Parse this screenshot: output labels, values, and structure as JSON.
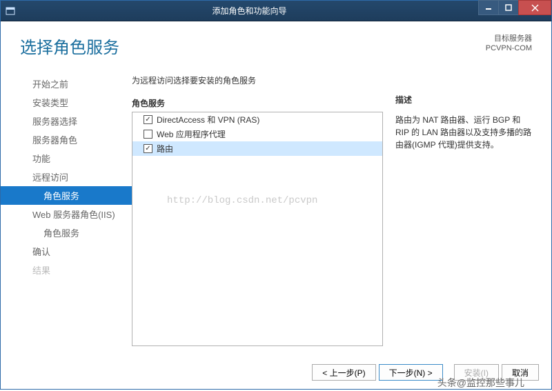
{
  "titlebar": {
    "title": "添加角色和功能向导"
  },
  "header": {
    "page_title": "选择角色服务",
    "target_label": "目标服务器",
    "target_name": "PCVPN-COM"
  },
  "sidebar": {
    "items": [
      {
        "label": "开始之前"
      },
      {
        "label": "安装类型"
      },
      {
        "label": "服务器选择"
      },
      {
        "label": "服务器角色"
      },
      {
        "label": "功能"
      },
      {
        "label": "远程访问"
      },
      {
        "label": "角色服务"
      },
      {
        "label": "Web 服务器角色(IIS)"
      },
      {
        "label": "角色服务"
      },
      {
        "label": "确认"
      },
      {
        "label": "结果"
      }
    ]
  },
  "main": {
    "instruction": "为远程访问选择要安装的角色服务",
    "roles_label": "角色服务",
    "roles": [
      {
        "label": "DirectAccess 和 VPN (RAS)",
        "checked": true,
        "selected": false
      },
      {
        "label": "Web 应用程序代理",
        "checked": false,
        "selected": false
      },
      {
        "label": "路由",
        "checked": true,
        "selected": true
      }
    ],
    "watermark": "http://blog.csdn.net/pcvpn",
    "desc_label": "描述",
    "desc_text": "路由为 NAT 路由器、运行 BGP 和 RIP 的 LAN 路由器以及支持多播的路由器(IGMP 代理)提供支持。"
  },
  "footer": {
    "prev": "< 上一步(P)",
    "next": "下一步(N) >",
    "install": "安装(I)",
    "cancel": "取消"
  },
  "annotation": "头条@监控那些事儿"
}
